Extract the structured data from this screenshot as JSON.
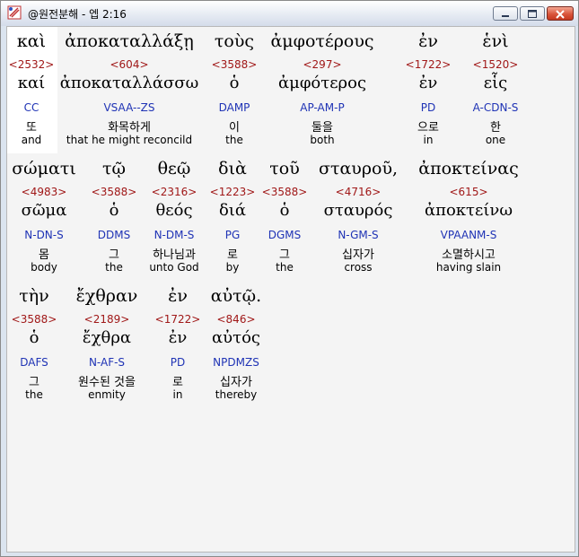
{
  "window": {
    "title": "@원전분해 - 엡 2:16",
    "controls": [
      "minimize",
      "maximize",
      "close"
    ]
  },
  "lines": [
    [
      {
        "greek": "καὶ",
        "strong": "<2532>",
        "lemma": "καί",
        "parse": "CC",
        "korean": "또",
        "english": "and"
      },
      {
        "greek": "ἀποκαταλλάξῃ",
        "strong": "<604>",
        "lemma": "ἀποκαταλλάσσω",
        "parse": "VSAA--ZS",
        "korean": "화목하게",
        "english": "that he might reconcild"
      },
      {
        "greek": "τοὺς",
        "strong": "<3588>",
        "lemma": "ὁ",
        "parse": "DAMP",
        "korean": "이",
        "english": "the"
      },
      {
        "greek": "ἀμφοτέρους",
        "strong": "<297>",
        "lemma": "ἀμφότερος",
        "parse": "AP-AM-P",
        "korean": "둘을",
        "english": "both"
      },
      {
        "greek": "ἐν",
        "strong": "<1722>",
        "lemma": "ἐν",
        "parse": "PD",
        "korean": "으로",
        "english": "in"
      },
      {
        "greek": "ἑνὶ",
        "strong": "<1520>",
        "lemma": "εἷς",
        "parse": "A-CDN-S",
        "korean": "한",
        "english": "one"
      }
    ],
    [
      {
        "greek": "σώματι",
        "strong": "<4983>",
        "lemma": "σῶμα",
        "parse": "N-DN-S",
        "korean": "몸",
        "english": "body"
      },
      {
        "greek": "τῷ",
        "strong": "<3588>",
        "lemma": "ὁ",
        "parse": "DDMS",
        "korean": "그",
        "english": "the"
      },
      {
        "greek": "θεῷ",
        "strong": "<2316>",
        "lemma": "θεός",
        "parse": "N-DM-S",
        "korean": "하나님과",
        "english": "unto God"
      },
      {
        "greek": "διὰ",
        "strong": "<1223>",
        "lemma": "διά",
        "parse": "PG",
        "korean": "로",
        "english": "by"
      },
      {
        "greek": "τοῦ",
        "strong": "<3588>",
        "lemma": "ὁ",
        "parse": "DGMS",
        "korean": "그",
        "english": "the"
      },
      {
        "greek": "σταυροῦ,",
        "strong": "<4716>",
        "lemma": "σταυρός",
        "parse": "N-GM-S",
        "korean": "십자가",
        "english": "cross"
      },
      {
        "greek": "ἀποκτείνας",
        "strong": "<615>",
        "lemma": "ἀποκτείνω",
        "parse": "VPAANM-S",
        "korean": "소멸하시고",
        "english": "having slain"
      }
    ],
    [
      {
        "greek": "τὴν",
        "strong": "<3588>",
        "lemma": "ὁ",
        "parse": "DAFS",
        "korean": "그",
        "english": "the"
      },
      {
        "greek": "ἔχθραν",
        "strong": "<2189>",
        "lemma": "ἔχθρα",
        "parse": "N-AF-S",
        "korean": "원수된 것을",
        "english": "enmity"
      },
      {
        "greek": "ἐν",
        "strong": "<1722>",
        "lemma": "ἐν",
        "parse": "PD",
        "korean": "로",
        "english": "in"
      },
      {
        "greek": "αὐτῷ.",
        "strong": "<846>",
        "lemma": "αὐτός",
        "parse": "NPDMZS",
        "korean": "십자가",
        "english": "thereby"
      }
    ]
  ]
}
